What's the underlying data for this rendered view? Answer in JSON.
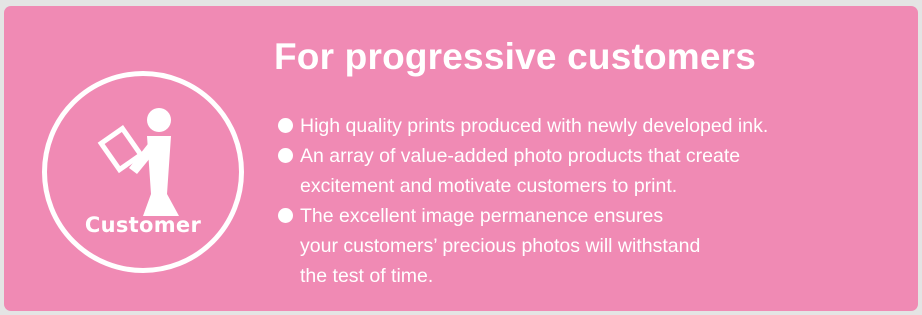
{
  "panel": {
    "title": "For progressive customers",
    "badge": {
      "icon": "reading-person-icon",
      "label": "Customer"
    },
    "bullets": [
      {
        "lines": [
          "High quality prints produced with newly developed ink."
        ]
      },
      {
        "lines": [
          "An array of value-added photo products that create",
          "excitement and motivate customers to print."
        ]
      },
      {
        "lines": [
          "The excellent image permanence ensures",
          "your customers’ precious photos will withstand",
          "the test of time."
        ]
      }
    ]
  },
  "colors": {
    "panel_background": "#f08ab4",
    "page_background": "#e4e4e4",
    "text": "#ffffff"
  }
}
